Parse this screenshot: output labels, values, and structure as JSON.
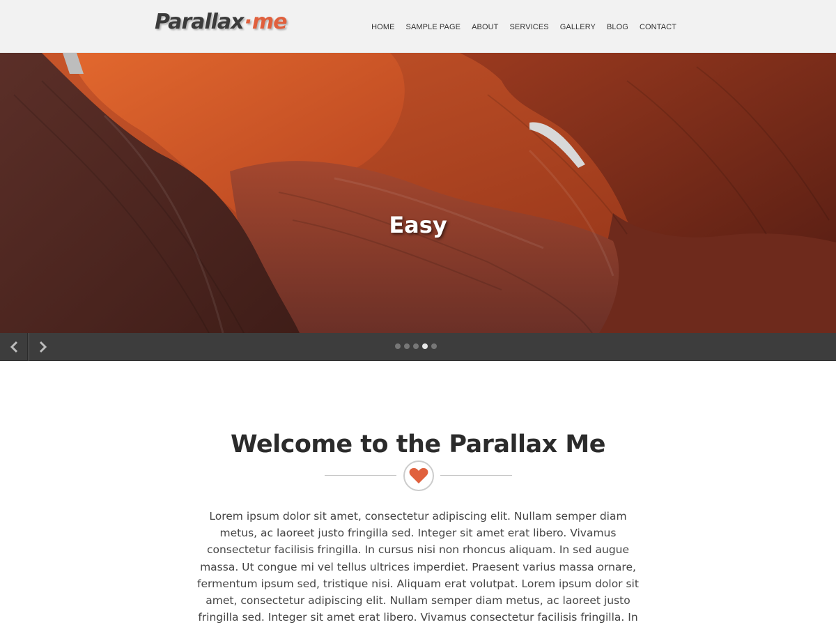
{
  "site": {
    "logo_main": "Parallax",
    "logo_sep": "·",
    "logo_accent": "me"
  },
  "nav": {
    "items": [
      "HOME",
      "SAMPLE PAGE",
      "ABOUT",
      "SERVICES",
      "GALLERY",
      "BLOG",
      "CONTACT"
    ]
  },
  "hero": {
    "caption": "Easy",
    "slides_count": 5,
    "active_slide": 4
  },
  "welcome": {
    "title": "Welcome to the Parallax Me",
    "divider_icon": "heart-icon",
    "body": "Lorem ipsum dolor sit amet, consectetur adipiscing elit. Nullam semper diam metus, ac laoreet justo fringilla sed. Integer sit amet erat libero. Vivamus consectetur facilisis fringilla. In cursus nisi non rhoncus aliquam. In sed augue massa. Ut congue mi vel tellus ultrices imperdiet. Praesent varius massa ornare, fermentum ipsum sed, tristique nisi. Aliquam erat volutpat. Lorem ipsum dolor sit amet, consectetur adipiscing elit. Nullam semper diam metus, ac laoreet justo fringilla sed. Integer sit amet erat libero. Vivamus consectetur facilisis fringilla. In cursus nisi non rhoncus aliquam. In sed augue"
  },
  "colors": {
    "accent": "#e0603d",
    "header_bg": "#f2f2f2",
    "slider_bar_bg": "#3d3d3d",
    "text": "#444444"
  }
}
